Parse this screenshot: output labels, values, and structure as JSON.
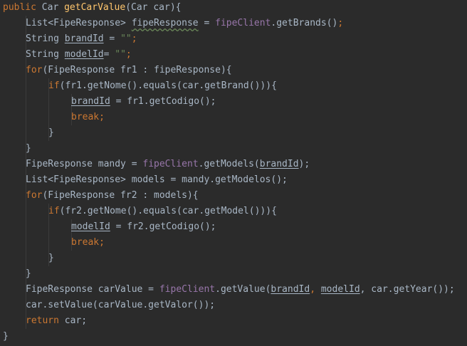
{
  "code": {
    "kw_public": "public",
    "type_car": "Car",
    "method_getcarvalue": "getCarValue",
    "sig_params": "(Car car){",
    "l2_a": "List<FipeResponse> ",
    "l2_var": "fipeResponse",
    "l2_eq": " = ",
    "fipe_client": "fipeClient",
    "l2_call": ".getBrands()",
    "semicolon": ";",
    "l3_type": "String ",
    "brand_id": "brandId",
    "l3_eq": " = ",
    "empty_str": "\"\"",
    "model_id": "modelId",
    "l4_eq": "= ",
    "kw_for": "for",
    "l5_rest": "(FipeResponse fr1 : fipeResponse){",
    "kw_if": "if",
    "l6_rest": "(fr1.getNome().equals(car.getBrand())){",
    "l7_rest": " = fr1.getCodigo();",
    "kw_break": "break",
    "close_brace": "}",
    "l11_a": "FipeResponse mandy = ",
    "l11_call": ".getModels(",
    "l11_end": ");",
    "l12": "List<FipeResponse> models = mandy.getModelos();",
    "l13_rest": "(FipeResponse fr2 : models){",
    "l14_rest": "(fr2.getNome().equals(car.getModel())){",
    "l15_rest": " = fr2.getCodigo();",
    "l19_a": "FipeResponse carValue = ",
    "l19_call": ".getValue(",
    "comma": ", ",
    "l19_end": ", car.getYear());",
    "l20": "car.setValue(carValue.getValor());",
    "kw_return": "return",
    "l21_rest": " car;"
  }
}
